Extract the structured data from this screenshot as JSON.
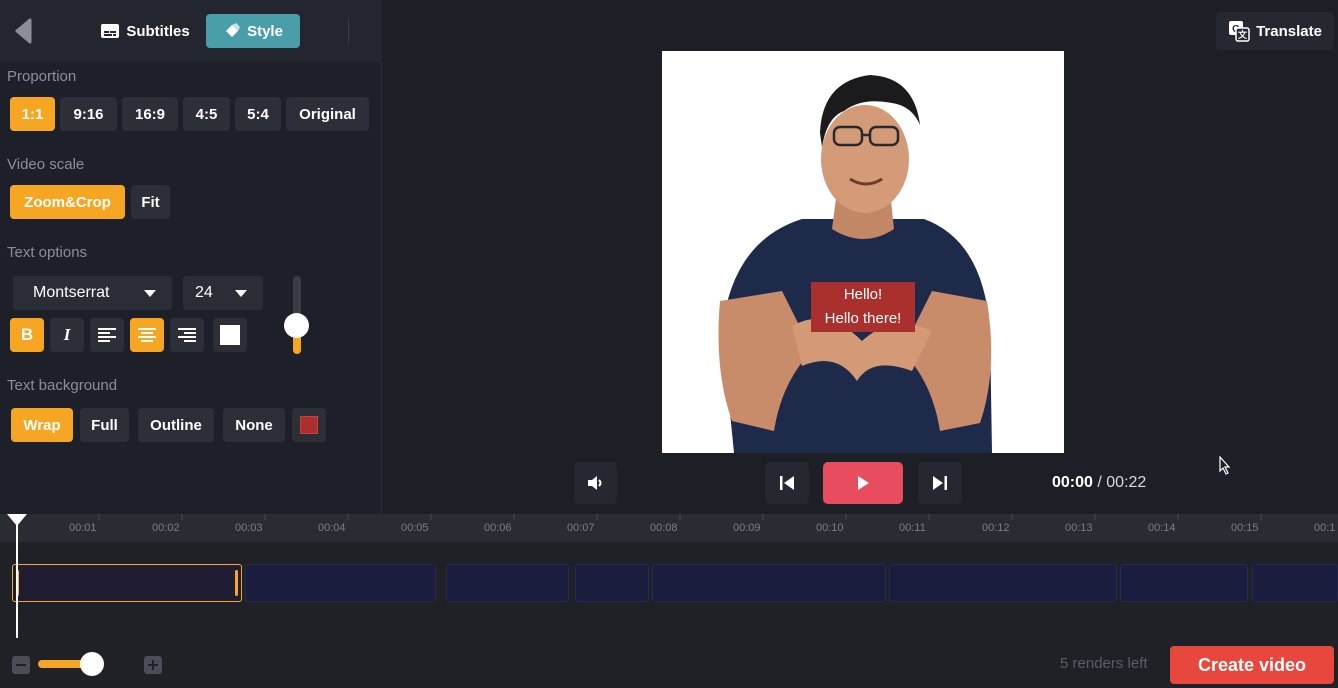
{
  "tabs": {
    "subtitles": "Subtitles",
    "style": "Style"
  },
  "proportion": {
    "label": "Proportion",
    "options": [
      "1:1",
      "9:16",
      "16:9",
      "4:5",
      "5:4",
      "Original"
    ],
    "selected": "1:1"
  },
  "video_scale": {
    "label": "Video scale",
    "options": [
      "Zoom&Crop",
      "Fit"
    ],
    "selected": "Zoom&Crop"
  },
  "text_options": {
    "label": "Text options",
    "font": "Montserrat",
    "size": "24",
    "bold_label": "B",
    "italic_label": "I",
    "alignment": "center",
    "bold": true,
    "color": "#ffffff"
  },
  "text_background": {
    "label": "Text background",
    "options": [
      "Wrap",
      "Full",
      "Outline",
      "None"
    ],
    "selected": "Wrap",
    "color": "#a9302c"
  },
  "translate": {
    "label": "Translate"
  },
  "subtitle": {
    "line1": "Hello!",
    "line2": "Hello there!"
  },
  "player": {
    "current": "00:00",
    "separator": "/",
    "total": "00:22"
  },
  "timeline": {
    "ticks": [
      "00:01",
      "00:02",
      "00:03",
      "00:04",
      "00:05",
      "00:06",
      "00:07",
      "00:08",
      "00:09",
      "00:10",
      "00:11",
      "00:12",
      "00:13",
      "00:14",
      "00:15",
      "00:1"
    ]
  },
  "footer": {
    "renders_left": "5 renders left",
    "create_label": "Create video"
  },
  "colors": {
    "accent": "#f6a623",
    "teal": "#4a9ea9",
    "play": "#e84c5f",
    "create": "#e8473d"
  }
}
